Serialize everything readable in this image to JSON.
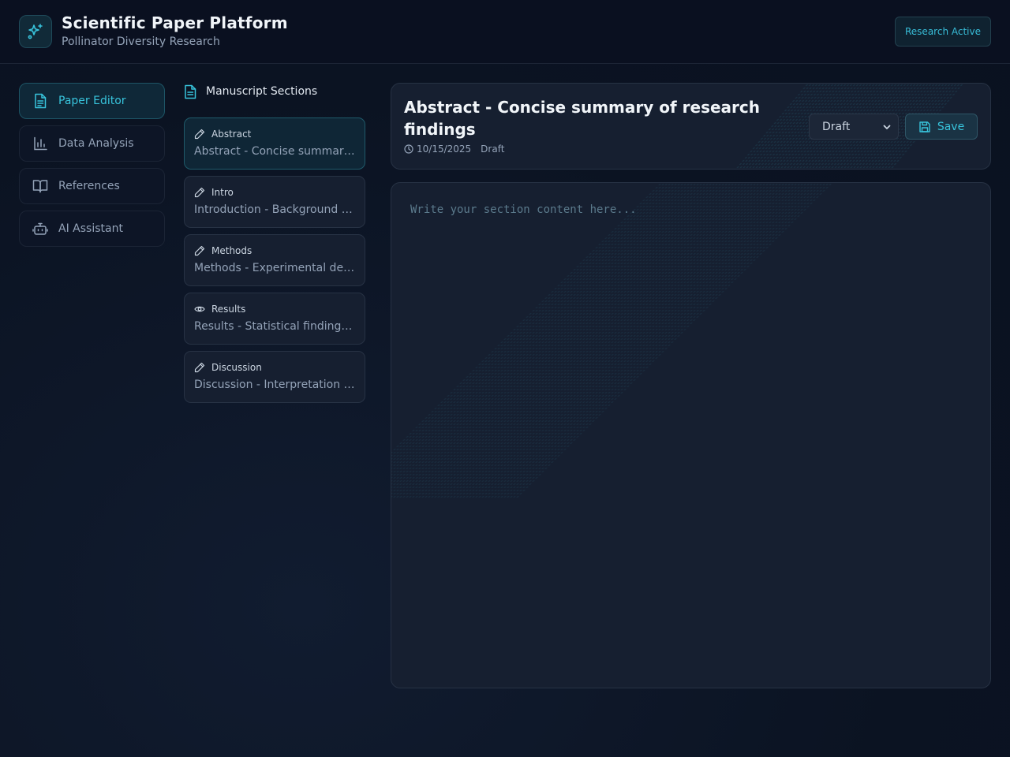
{
  "header": {
    "title": "Scientific Paper Platform",
    "subtitle": "Pollinator Diversity Research",
    "badge": "Research Active"
  },
  "nav": [
    {
      "label": "Paper Editor",
      "icon": "document-icon",
      "active": true
    },
    {
      "label": "Data Analysis",
      "icon": "bar-chart-icon",
      "active": false
    },
    {
      "label": "References",
      "icon": "book-icon",
      "active": false
    },
    {
      "label": "AI Assistant",
      "icon": "bot-icon",
      "active": false
    }
  ],
  "sections": {
    "heading": "Manuscript Sections",
    "items": [
      {
        "name": "Abstract",
        "summary": "Abstract - Concise summary of research findings",
        "icon": "pencil-icon",
        "active": true
      },
      {
        "name": "Intro",
        "summary": "Introduction - Background and research questions",
        "icon": "pencil-icon",
        "active": false
      },
      {
        "name": "Methods",
        "summary": "Methods - Experimental design and procedures",
        "icon": "pencil-icon",
        "active": false
      },
      {
        "name": "Results",
        "summary": "Results - Statistical findings and data",
        "icon": "eye-icon",
        "active": false
      },
      {
        "name": "Discussion",
        "summary": "Discussion - Interpretation of results",
        "icon": "pencil-icon",
        "active": false
      }
    ]
  },
  "editor": {
    "title": "Abstract - Concise summary of research findings",
    "date": "10/15/2025",
    "status": "Draft",
    "status_selected": "Draft",
    "save_label": "Save",
    "placeholder": "Write your section content here...",
    "content": ""
  },
  "colors": {
    "accent": "#38c4dc",
    "background": "#0b1322",
    "card": "#161f30"
  }
}
